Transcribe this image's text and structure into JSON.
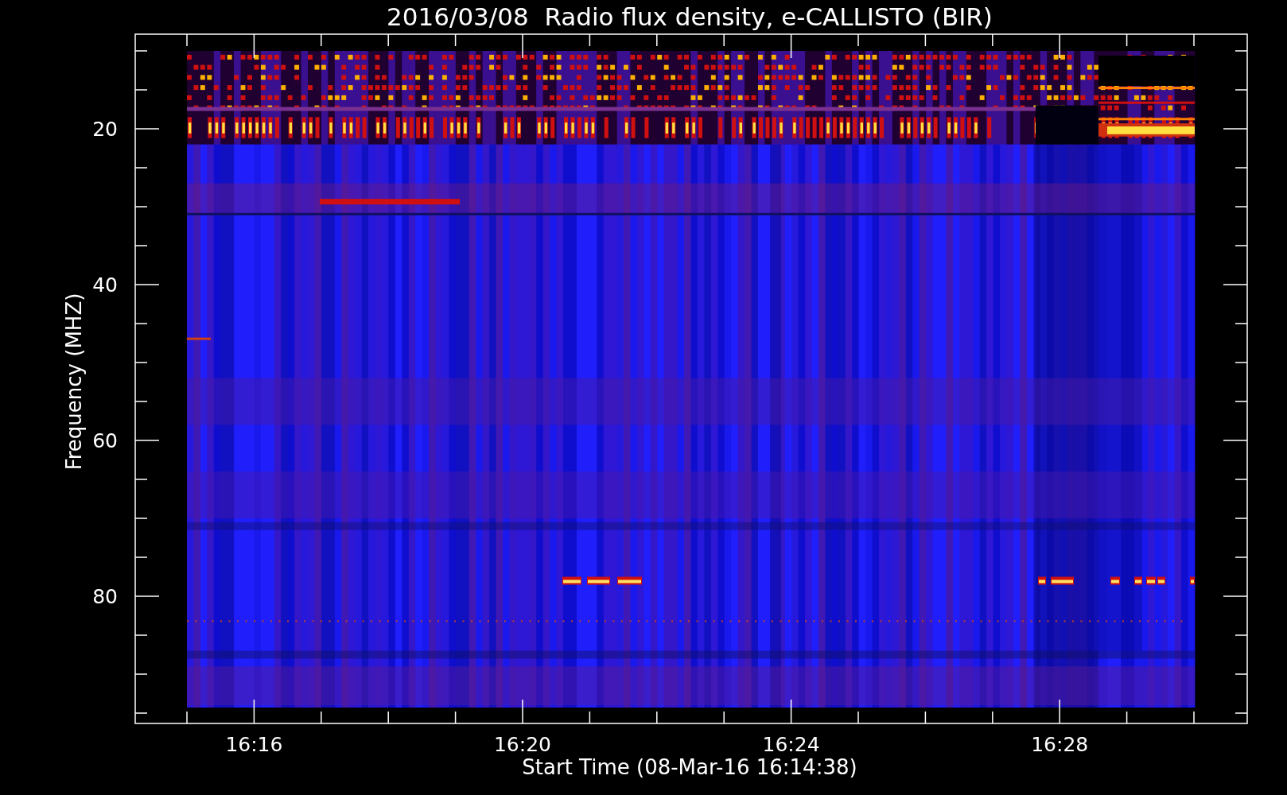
{
  "plot": {
    "title": "2016/03/08  Radio flux density, e-CALLISTO (BIR)",
    "x_axis": {
      "label": "Start Time (08-Mar-16 16:14:38)",
      "tick_labels": [
        "16:16",
        "16:20",
        "16:24",
        "16:28"
      ]
    },
    "y_axis": {
      "label": "Frequency (MHZ)",
      "tick_labels": [
        "20",
        "40",
        "60",
        "80"
      ]
    }
  }
}
